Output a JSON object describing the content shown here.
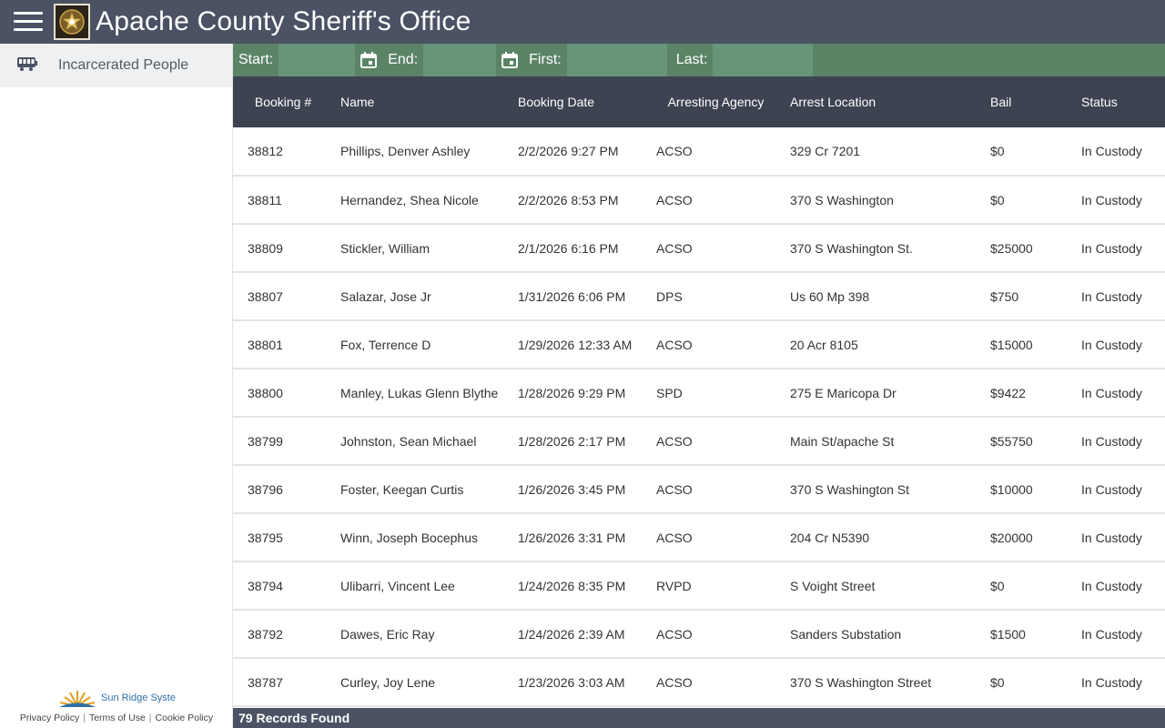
{
  "header": {
    "title": "Apache County Sheriff's Office"
  },
  "sidebar": {
    "items": [
      {
        "label": "Incarcerated People",
        "icon": "bus-icon"
      }
    ],
    "footer": {
      "brand": "Sun Ridge Syste",
      "links": [
        "Privacy Policy",
        "Terms of Use",
        "Cookie Policy"
      ]
    }
  },
  "filters": {
    "start_label": "Start:",
    "end_label": "End:",
    "first_label": "First:",
    "last_label": "Last:"
  },
  "table": {
    "headers": {
      "booking": "Booking #",
      "name": "Name",
      "booking_date": "Booking Date",
      "agency": "Arresting Agency",
      "location": "Arrest Location",
      "bail": "Bail",
      "status": "Status"
    },
    "rows": [
      {
        "booking": "38812",
        "name": "Phillips, Denver Ashley",
        "date": "2/2/2026 9:27 PM",
        "agency": "ACSO",
        "location": "329 Cr 7201",
        "bail": "$0",
        "status": "In Custody"
      },
      {
        "booking": "38811",
        "name": "Hernandez, Shea Nicole",
        "date": "2/2/2026 8:53 PM",
        "agency": "ACSO",
        "location": "370 S Washington",
        "bail": "$0",
        "status": "In Custody"
      },
      {
        "booking": "38809",
        "name": "Stickler, William",
        "date": "2/1/2026 6:16 PM",
        "agency": "ACSO",
        "location": "370 S Washington St.",
        "bail": "$25000",
        "status": "In Custody"
      },
      {
        "booking": "38807",
        "name": "Salazar, Jose Jr",
        "date": "1/31/2026 6:06 PM",
        "agency": "DPS",
        "location": "Us 60 Mp 398",
        "bail": "$750",
        "status": "In Custody"
      },
      {
        "booking": "38801",
        "name": "Fox, Terrence D",
        "date": "1/29/2026 12:33 AM",
        "agency": "ACSO",
        "location": "20 Acr 8105",
        "bail": "$15000",
        "status": "In Custody"
      },
      {
        "booking": "38800",
        "name": "Manley, Lukas Glenn Blythe",
        "date": "1/28/2026 9:29 PM",
        "agency": "SPD",
        "location": "275 E Maricopa Dr",
        "bail": "$9422",
        "status": "In Custody"
      },
      {
        "booking": "38799",
        "name": "Johnston, Sean Michael",
        "date": "1/28/2026 2:17 PM",
        "agency": "ACSO",
        "location": "Main St/apache St",
        "bail": "$55750",
        "status": "In Custody"
      },
      {
        "booking": "38796",
        "name": "Foster, Keegan Curtis",
        "date": "1/26/2026 3:45 PM",
        "agency": "ACSO",
        "location": "370 S Washington St",
        "bail": "$10000",
        "status": "In Custody"
      },
      {
        "booking": "38795",
        "name": "Winn, Joseph Bocephus",
        "date": "1/26/2026 3:31 PM",
        "agency": "ACSO",
        "location": "204 Cr N5390",
        "bail": "$20000",
        "status": "In Custody"
      },
      {
        "booking": "38794",
        "name": "Ulibarri, Vincent Lee",
        "date": "1/24/2026 8:35 PM",
        "agency": "RVPD",
        "location": "S Voight Street",
        "bail": "$0",
        "status": "In Custody"
      },
      {
        "booking": "38792",
        "name": "Dawes, Eric Ray",
        "date": "1/24/2026 2:39 AM",
        "agency": "ACSO",
        "location": "Sanders Substation",
        "bail": "$1500",
        "status": "In Custody"
      },
      {
        "booking": "38787",
        "name": "Curley, Joy Lene",
        "date": "1/23/2026 3:03 AM",
        "agency": "ACSO",
        "location": "370 S Washington Street",
        "bail": "$0",
        "status": "In Custody"
      }
    ]
  },
  "status": {
    "records": "79 Records Found"
  },
  "colors": {
    "header": "#4a5264",
    "filter_bar": "#5b8467",
    "table_header": "#3d4351"
  }
}
